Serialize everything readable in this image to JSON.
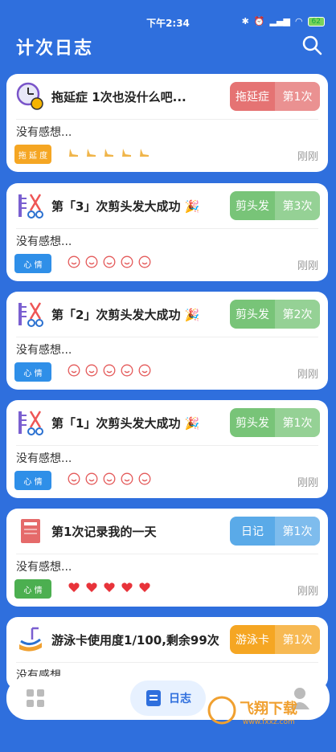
{
  "status_bar": {
    "time": "下午2:34",
    "battery": "62",
    "icons": [
      "bluetooth-icon",
      "alarm-icon",
      "signal-icon",
      "wifi-icon",
      "battery-icon"
    ]
  },
  "header": {
    "title": "计次日志",
    "search_icon": "search-icon"
  },
  "cards": [
    {
      "title": "拖延症 1次也没什么吧...",
      "category": "拖延症",
      "count": "第1次",
      "pill_color": "#e57373",
      "thoughts": "没有感想...",
      "chip": "拖 延 度",
      "chip_color": "#f5a623",
      "mark_type": "shoe",
      "marks": 5,
      "time": "刚刚",
      "icon": "clock-coin-icon"
    },
    {
      "title": "第「3」次剪头发大成功 🎉",
      "category": "剪头发",
      "count": "第3次",
      "pill_color": "#78c478",
      "thoughts": "没有感想...",
      "chip": "心 情",
      "chip_color": "#2f8fe8",
      "mark_type": "smile",
      "marks": 5,
      "time": "刚刚",
      "icon": "comb-scissors-icon"
    },
    {
      "title": "第「2」次剪头发大成功 🎉",
      "category": "剪头发",
      "count": "第2次",
      "pill_color": "#78c478",
      "thoughts": "没有感想...",
      "chip": "心 情",
      "chip_color": "#2f8fe8",
      "mark_type": "smile",
      "marks": 5,
      "time": "刚刚",
      "icon": "comb-scissors-icon"
    },
    {
      "title": "第「1」次剪头发大成功 🎉",
      "category": "剪头发",
      "count": "第1次",
      "pill_color": "#78c478",
      "thoughts": "没有感想...",
      "chip": "心 情",
      "chip_color": "#2f8fe8",
      "mark_type": "smile",
      "marks": 5,
      "time": "刚刚",
      "icon": "comb-scissors-icon"
    },
    {
      "title": "第1次记录我的一天",
      "category": "日记",
      "count": "第1次",
      "pill_color": "#5aaae8",
      "thoughts": "没有感想...",
      "chip": "心 情",
      "chip_color": "#4caf50",
      "mark_type": "heart",
      "marks": 5,
      "time": "刚刚",
      "icon": "notebook-icon"
    },
    {
      "title": "游泳卡使用度1/100,剩余99次",
      "category": "游泳卡",
      "count": "第1次",
      "pill_color": "#f5a623",
      "thoughts": "没有感想...",
      "chip": "",
      "chip_color": "#4caf50",
      "mark_type": "none",
      "marks": 0,
      "time": "",
      "icon": "swim-card-icon"
    }
  ],
  "bottom_nav": {
    "active_label": "日志",
    "items": [
      "grid-icon",
      "journal-icon",
      "user-icon"
    ]
  },
  "watermark": {
    "text": "飞翔下载",
    "sub": "www.fxxz.com"
  }
}
